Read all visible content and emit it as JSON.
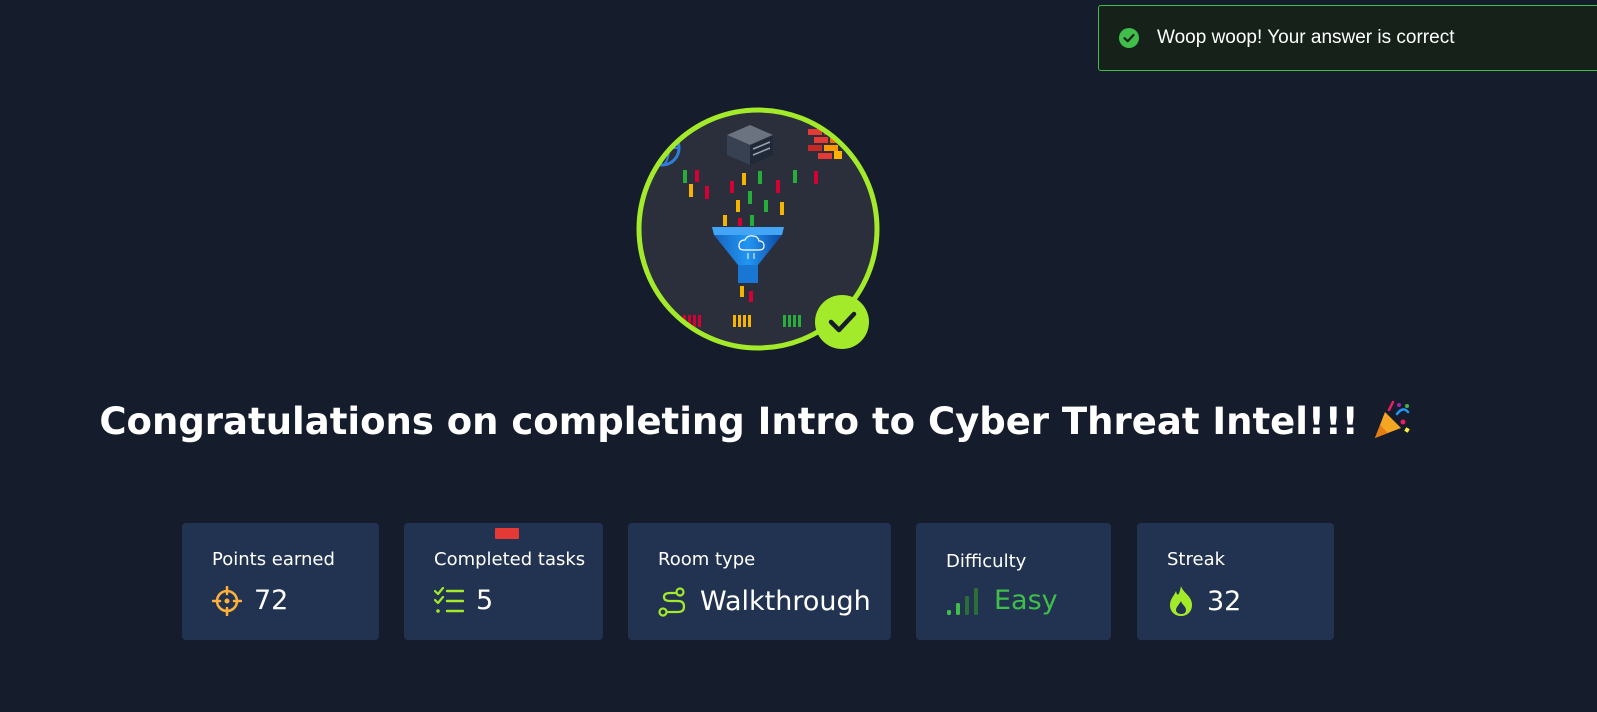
{
  "toast": {
    "message": "Woop woop! Your answer is correct",
    "color": "#3fbf4a"
  },
  "badge": {
    "ring_color": "#a3ea2a",
    "check_icon": "check-icon"
  },
  "heading": {
    "text": "Congratulations on completing Intro to Cyber Threat Intel!!!",
    "emoji_icon": "party-popper-icon"
  },
  "stats": [
    {
      "label": "Points earned",
      "value": "72",
      "icon": "crosshair-icon"
    },
    {
      "label": "Completed tasks",
      "value": "5",
      "icon": "task-list-icon"
    },
    {
      "label": "Room type",
      "value": "Walkthrough",
      "icon": "route-icon"
    },
    {
      "label": "Difficulty",
      "value": "Easy",
      "icon": "signal-bars-icon"
    },
    {
      "label": "Streak",
      "value": "32",
      "icon": "flame-icon"
    }
  ],
  "colors": {
    "background": "#151c2b",
    "card": "#223351",
    "accent_green": "#a3ea2a",
    "orange": "#ffb13b"
  }
}
